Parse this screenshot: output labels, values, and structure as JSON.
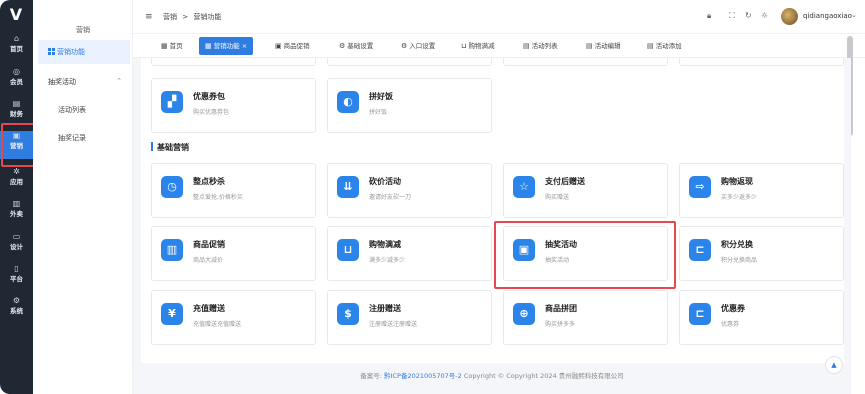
{
  "rail": {
    "logo": "V",
    "items": [
      {
        "icon": "⌂",
        "label": "首页"
      },
      {
        "icon": "◎",
        "label": "会员"
      },
      {
        "icon": "▤",
        "label": "财务"
      },
      {
        "icon": "▣",
        "label": "营销"
      },
      {
        "icon": "✲",
        "label": "应用"
      },
      {
        "icon": "▥",
        "label": "外卖"
      },
      {
        "icon": "▭",
        "label": "设计"
      },
      {
        "icon": "▯",
        "label": "平台"
      },
      {
        "icon": "⚙",
        "label": "系统"
      }
    ]
  },
  "submenu": {
    "title": "营销",
    "active": "营销功能",
    "group": "抽奖活动",
    "group_chevron": "⌃",
    "links": [
      "活动列表",
      "抽奖记录"
    ]
  },
  "header": {
    "hamburger": "≡",
    "breadcrumb": [
      "营销",
      ">",
      "营销功能"
    ],
    "icons": [
      "lock-icon",
      "fullscreen-icon",
      "refresh-icon",
      "theme-icon"
    ],
    "username": "qidiangaoxiao",
    "user_chevron": "⌄"
  },
  "tabs": [
    {
      "label": "首页"
    },
    {
      "label": "营销功能",
      "close": "×",
      "active": true
    },
    {
      "label": "商品促销"
    },
    {
      "label": "基础设置"
    },
    {
      "label": "入口设置"
    },
    {
      "label": "购物满减"
    },
    {
      "label": "活动列表"
    },
    {
      "label": "活动编辑"
    },
    {
      "label": "活动添加"
    }
  ],
  "top_cards": [
    {
      "title": "优惠券包",
      "desc": "购买优惠券包",
      "icon": "coupon-pack-icon"
    },
    {
      "title": "拼好饭",
      "desc": "拼好饭",
      "icon": "group-meal-icon"
    }
  ],
  "section": {
    "title": "基础营销"
  },
  "cards": [
    {
      "title": "整点秒杀",
      "desc": "整点爱抢,价格秒买",
      "icon": "flash-sale-icon"
    },
    {
      "title": "砍价活动",
      "desc": "邀请好友砍一刀",
      "icon": "bargain-icon"
    },
    {
      "title": "支付后赠送",
      "desc": "购买赠送",
      "icon": "payment-gift-icon"
    },
    {
      "title": "购物返现",
      "desc": "买多少返多少",
      "icon": "cashback-icon"
    },
    {
      "title": "商品促销",
      "desc": "商品大减价",
      "icon": "promotion-icon"
    },
    {
      "title": "购物满减",
      "desc": "满多少减多少",
      "icon": "cart-discount-icon"
    },
    {
      "title": "抽奖活动",
      "desc": "抽奖活动",
      "icon": "lottery-icon"
    },
    {
      "title": "积分兑换",
      "desc": "积分兑换商品",
      "icon": "points-exchange-icon"
    },
    {
      "title": "充值赠送",
      "desc": "充值赠送充值赠送",
      "icon": "recharge-gift-icon"
    },
    {
      "title": "注册赠送",
      "desc": "注册赠送注册赠送",
      "icon": "register-gift-icon"
    },
    {
      "title": "商品拼团",
      "desc": "购买拼多多",
      "icon": "group-buy-icon"
    },
    {
      "title": "优惠券",
      "desc": "优惠券",
      "icon": "coupon-icon"
    }
  ],
  "footer": {
    "prefix": "备案号:",
    "icp": "黔ICP备2021005707号-2",
    "copyright": "Copyright  ©  Copyright 2024 贵州融熙科技有限公司"
  },
  "back_to_top": "▲",
  "colors": {
    "accent": "#2f7de1",
    "highlight": "#e5484d",
    "rail": "#1f2833"
  }
}
